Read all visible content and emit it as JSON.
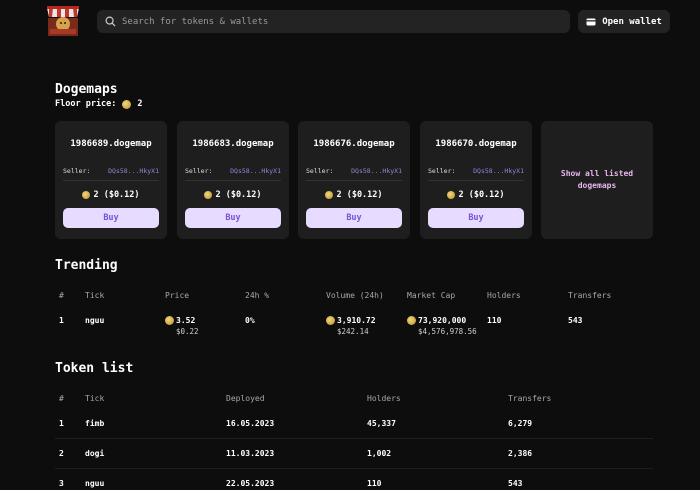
{
  "header": {
    "search_placeholder": "Search for tokens & wallets",
    "wallet_label": "Open wallet"
  },
  "dogemaps": {
    "title": "Dogemaps",
    "floor_label": "Floor price:",
    "floor_value": "2",
    "cards": [
      {
        "name": "1986689.dogemap",
        "seller_label": "Seller:",
        "seller": "DQs58...HkyX1",
        "price": "2 ($0.12)",
        "buy": "Buy"
      },
      {
        "name": "1986683.dogemap",
        "seller_label": "Seller:",
        "seller": "DQs58...HkyX1",
        "price": "2 ($0.12)",
        "buy": "Buy"
      },
      {
        "name": "1986676.dogemap",
        "seller_label": "Seller:",
        "seller": "DQs58...HkyX1",
        "price": "2 ($0.12)",
        "buy": "Buy"
      },
      {
        "name": "1986670.dogemap",
        "seller_label": "Seller:",
        "seller": "DQs58...HkyX1",
        "price": "2 ($0.12)",
        "buy": "Buy"
      }
    ],
    "show_all": "Show all listed dogemaps"
  },
  "trending": {
    "title": "Trending",
    "columns": [
      "#",
      "Tick",
      "Price",
      "24h %",
      "Volume (24h)",
      "Market Cap",
      "Holders",
      "Transfers"
    ],
    "rows": [
      {
        "rank": "1",
        "tick": "nguu",
        "price": "3.52",
        "price_usd": "$0.22",
        "change": "0%",
        "volume": "3,910.72",
        "volume_usd": "$242.14",
        "mcap": "73,920,000",
        "mcap_usd": "$4,576,978.56",
        "holders": "110",
        "transfers": "543"
      }
    ]
  },
  "tokens": {
    "title": "Token list",
    "columns": [
      "#",
      "Tick",
      "Deployed",
      "Holders",
      "Transfers"
    ],
    "rows": [
      {
        "rank": "1",
        "tick": "fimb",
        "deployed": "16.05.2023",
        "holders": "45,337",
        "transfers": "6,279"
      },
      {
        "rank": "2",
        "tick": "dogi",
        "deployed": "11.03.2023",
        "holders": "1,002",
        "transfers": "2,386"
      },
      {
        "rank": "3",
        "tick": "nguu",
        "deployed": "22.05.2023",
        "holders": "110",
        "transfers": "543"
      }
    ]
  },
  "colors": {
    "accent": "#e7dcff",
    "accent_text": "#7a52d6",
    "seller": "#8e87d8",
    "show_all": "#e8b6ee"
  }
}
